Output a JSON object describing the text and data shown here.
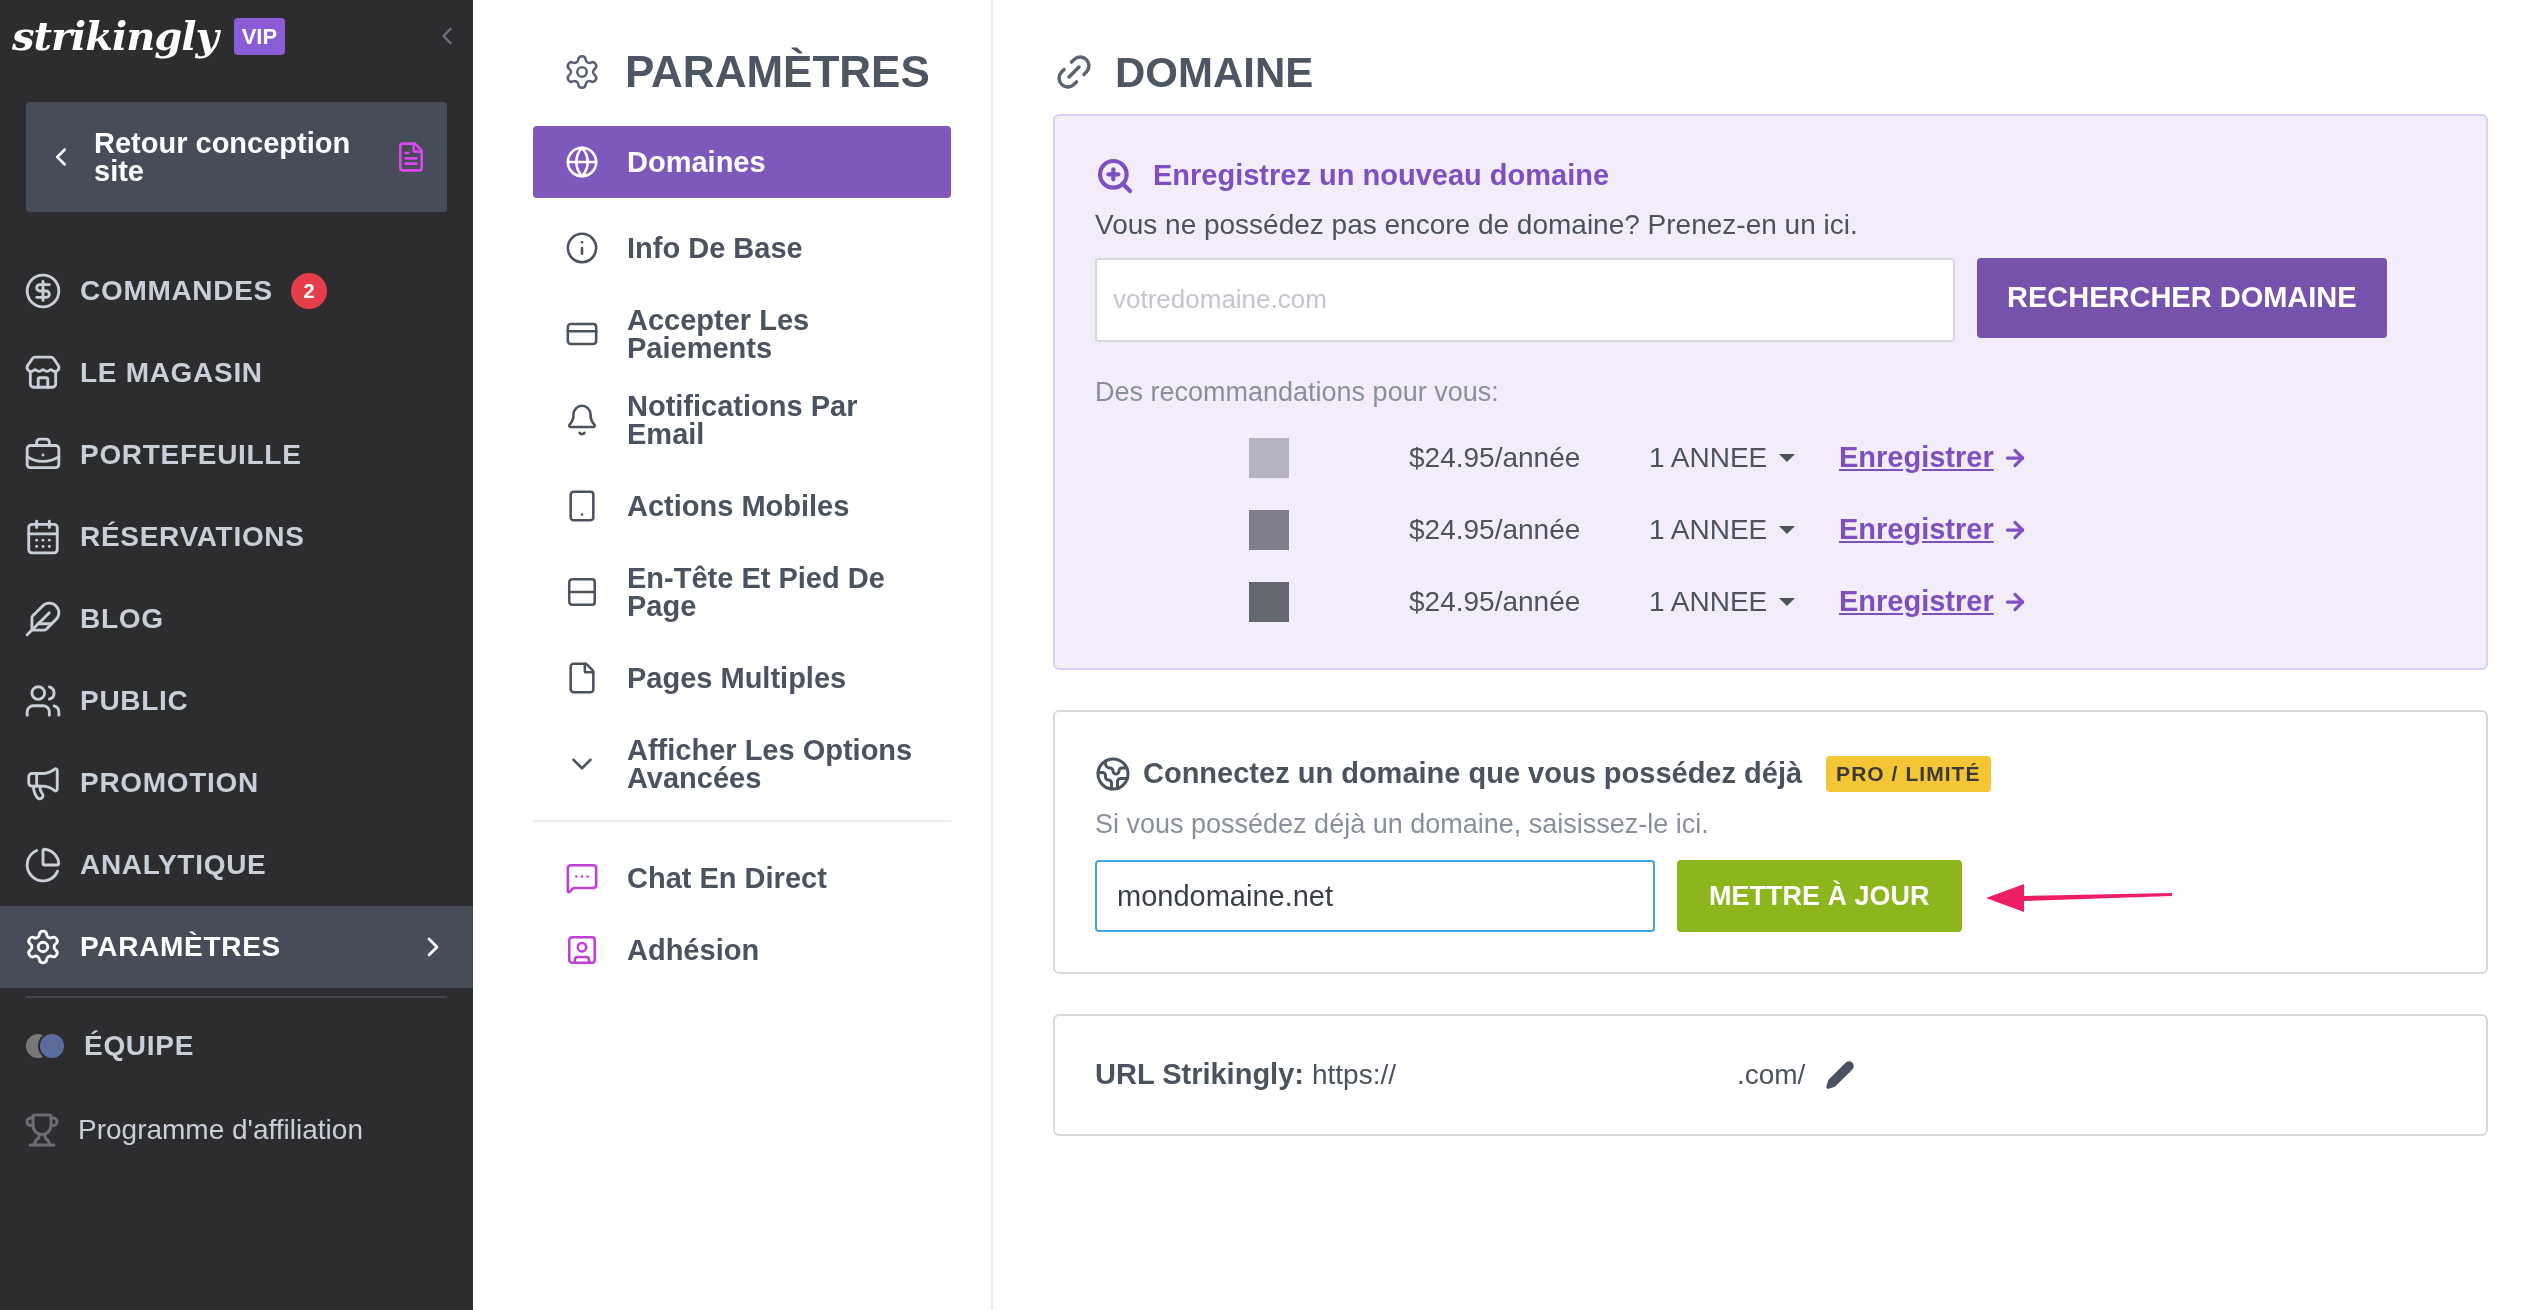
{
  "sidebar": {
    "logo": "strikingly",
    "plan_badge": "VIP",
    "back_button": "Retour conception site",
    "items": [
      {
        "label": "COMMANDES",
        "badge": "2",
        "selected": false
      },
      {
        "label": "LE MAGASIN",
        "selected": false
      },
      {
        "label": "PORTEFEUILLE",
        "selected": false
      },
      {
        "label": "RÉSERVATIONS",
        "selected": false
      },
      {
        "label": "BLOG",
        "selected": false
      },
      {
        "label": "PUBLIC",
        "selected": false
      },
      {
        "label": "PROMOTION",
        "selected": false
      },
      {
        "label": "ANALYTIQUE",
        "selected": false
      },
      {
        "label": "PARAMÈTRES",
        "selected": true
      }
    ],
    "footer_items": [
      {
        "kind": "team",
        "label": "ÉQUIPE"
      },
      {
        "kind": "affiliate",
        "label": "Programme d'affiliation"
      }
    ]
  },
  "settings": {
    "title": "PARAMÈTRES",
    "items": [
      {
        "label": "Domaines",
        "selected": true
      },
      {
        "label": "Info De Base",
        "selected": false
      },
      {
        "label": "Accepter Les Paiements",
        "selected": false
      },
      {
        "label": "Notifications Par Email",
        "selected": false
      },
      {
        "label": "Actions Mobiles",
        "selected": false
      },
      {
        "label": "En-Tête Et Pied De Page",
        "selected": false
      },
      {
        "label": "Pages Multiples",
        "selected": false
      },
      {
        "label": "Afficher Les Options Avancées",
        "selected": false
      }
    ],
    "extra_items": [
      {
        "label": "Chat En Direct",
        "selected": false
      },
      {
        "label": "Adhésion",
        "selected": false
      }
    ]
  },
  "domain": {
    "title": "DOMAINE",
    "register": {
      "title": "Enregistrez un nouveau domaine",
      "subtitle": "Vous ne possédez pas encore de domaine? Prenez-en un ici.",
      "placeholder": "votredomaine.com",
      "button": "RECHERCHER DOMAINE",
      "recommendations_label": "Des recommandations pour vous:",
      "rows": [
        {
          "color": "#b6b4c0",
          "price": "$24.95/année",
          "period": "1 ANNEE",
          "link": "Enregistrer"
        },
        {
          "color": "#7f7f8b",
          "price": "$24.95/année",
          "period": "1 ANNEE",
          "link": "Enregistrer"
        },
        {
          "color": "#636770",
          "price": "$24.95/année",
          "period": "1 ANNEE",
          "link": "Enregistrer"
        }
      ]
    },
    "connect": {
      "title": "Connectez un domaine que vous possédez déjà",
      "badge": "PRO / LIMITÉ",
      "subtitle": "Si vous possédez déjà un domaine, saisissez-le ici.",
      "value": "mondomaine.net",
      "button": "METTRE À JOUR"
    },
    "url": {
      "label": "URL Strikingly:",
      "prefix": "https://",
      "suffix": ".com/"
    }
  }
}
